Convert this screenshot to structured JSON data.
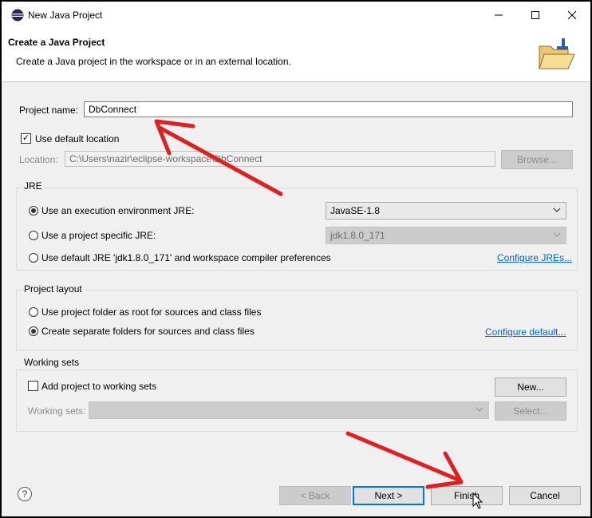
{
  "window": {
    "title": "New Java Project",
    "minimize": "—",
    "maximize": "☐",
    "close": "✕"
  },
  "header": {
    "title": "Create a Java Project",
    "description": "Create a Java project in the workspace or in an external location."
  },
  "project_name": {
    "label": "Project name:",
    "value": "DbConnect"
  },
  "default_location": {
    "label": "Use default location",
    "checked": true
  },
  "location": {
    "label": "Location:",
    "value": "C:\\Users\\nazir\\eclipse-workspace\\DbConnect",
    "browse": "Browse..."
  },
  "jre": {
    "title": "JRE",
    "option_env": "Use an execution environment JRE:",
    "env_value": "JavaSE-1.8",
    "option_specific": "Use a project specific JRE:",
    "specific_value": "jdk1.8.0_171",
    "option_default": "Use default JRE 'jdk1.8.0_171' and workspace compiler preferences",
    "configure": "Configure JREs..."
  },
  "layout": {
    "title": "Project layout",
    "option_root": "Use project folder as root for sources and class files",
    "option_separate": "Create separate folders for sources and class files",
    "configure": "Configure default..."
  },
  "working_sets": {
    "title": "Working sets",
    "add_label": "Add project to working sets",
    "new_button": "New...",
    "sets_label": "Working sets:",
    "select_button": "Select..."
  },
  "footer": {
    "help": "?",
    "back": "< Back",
    "next": "Next >",
    "finish": "Finish",
    "cancel": "Cancel"
  },
  "colors": {
    "annotation_arrow": "#e02020",
    "link": "#0066cc",
    "default_button_border": "#0078d7"
  }
}
